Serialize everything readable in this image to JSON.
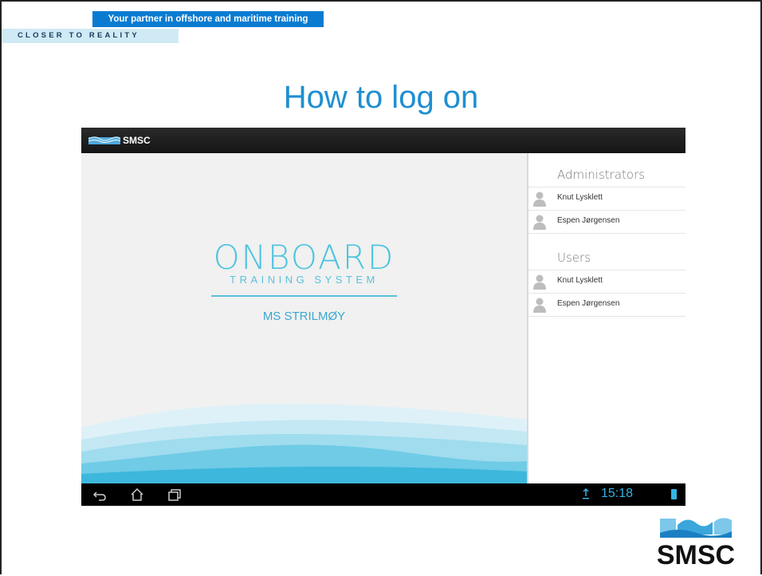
{
  "slide": {
    "partner_banner": "Your partner in offshore and maritime training",
    "tagline": "CLOSER TO REALITY",
    "title": "How to log on",
    "corner_logo_text": "SMSC"
  },
  "tablet": {
    "actionbar": {
      "app_name": "SMSC"
    },
    "splash": {
      "title": "ONBOARD",
      "subtitle": "TRAINING SYSTEM",
      "vessel": "MS STRILMØY"
    },
    "sidebar": {
      "sections": [
        {
          "header": "Administrators",
          "users": [
            "Knut Lysklett",
            "Espen Jørgensen"
          ]
        },
        {
          "header": "Users",
          "users": [
            "Knut Lysklett",
            "Espen Jørgensen"
          ]
        }
      ]
    },
    "navbar": {
      "icons": [
        "back-icon",
        "home-icon",
        "recent-apps-icon"
      ],
      "time": "15:18"
    }
  },
  "colors": {
    "accent_blue": "#1e8fd0",
    "banner_blue": "#0a7bd1",
    "tagline_bg": "#cfeaf5",
    "splash_cyan": "#4ec3e0",
    "clock_cyan": "#33b5e5"
  }
}
